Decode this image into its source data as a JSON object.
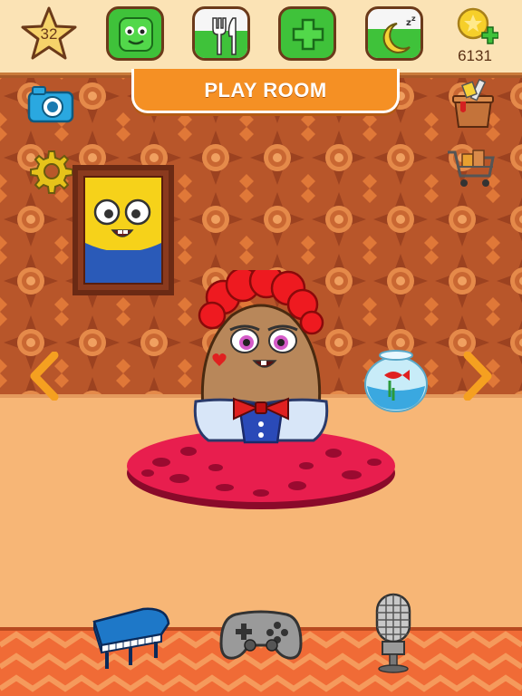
{
  "top_bar": {
    "level": "32",
    "coins": "6131"
  },
  "room": {
    "title": "PLAY ROOM"
  },
  "icons": {
    "level": "star-icon",
    "health": "green-face-icon",
    "food": "fork-knife-icon",
    "medicine": "plus-cross-icon",
    "sleep": "moon-icon",
    "coins": "coin-icon",
    "camera": "camera-icon",
    "settings": "gear-icon",
    "paint": "paint-bucket-icon",
    "shop": "shopping-cart-icon",
    "piano": "piano-icon",
    "gamepad": "gamepad-icon",
    "microphone": "microphone-icon"
  },
  "stat_levels": {
    "health": 1.0,
    "food": 0.55,
    "medicine": 1.0,
    "sleep": 0.6
  },
  "colors": {
    "accent_orange": "#f59024",
    "meter_green": "#3fc23a",
    "wallpaper": "#b9582a",
    "floor": "#f7b676"
  }
}
